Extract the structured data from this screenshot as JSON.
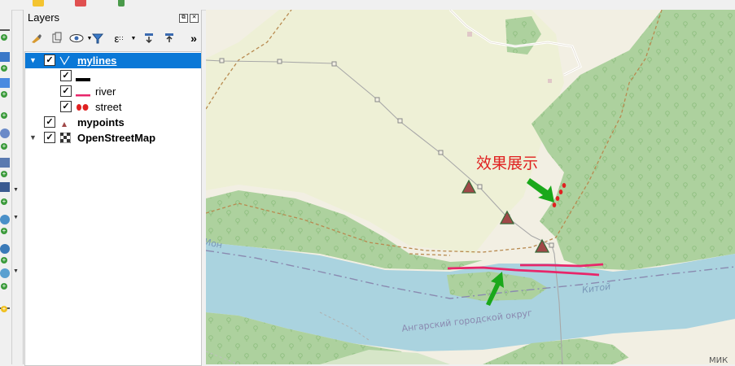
{
  "layers_panel": {
    "title": "Layers",
    "float_button": "⧉",
    "close_button": "✕",
    "more_button": "»"
  },
  "layers": [
    {
      "name": "mylines",
      "checked": true,
      "expanded": true,
      "selected": true
    },
    {
      "name": "",
      "checked": true,
      "symbol": "black-line"
    },
    {
      "name": "river",
      "checked": true,
      "symbol": "pink-line"
    },
    {
      "name": "street",
      "checked": true,
      "symbol": "red-dots"
    },
    {
      "name": "mypoints",
      "checked": true,
      "symbol": "red-triangle"
    },
    {
      "name": "OpenStreetMap",
      "checked": true,
      "expanded": false,
      "symbol": "raster-icon"
    }
  ],
  "map": {
    "annotation": "效果展示",
    "river_label_1": "Ион",
    "river_label_2": "Китой",
    "district_label": "Ангарский городской округ",
    "corner_label": "МИК",
    "colors": {
      "land": "#f2efe3",
      "field": "#eef0d6",
      "forest": "#add19e",
      "water": "#aad3df",
      "river_line": "#e8266a",
      "street_dot": "#e02020",
      "point": "#a04848",
      "arrow": "#1aa81a"
    }
  }
}
